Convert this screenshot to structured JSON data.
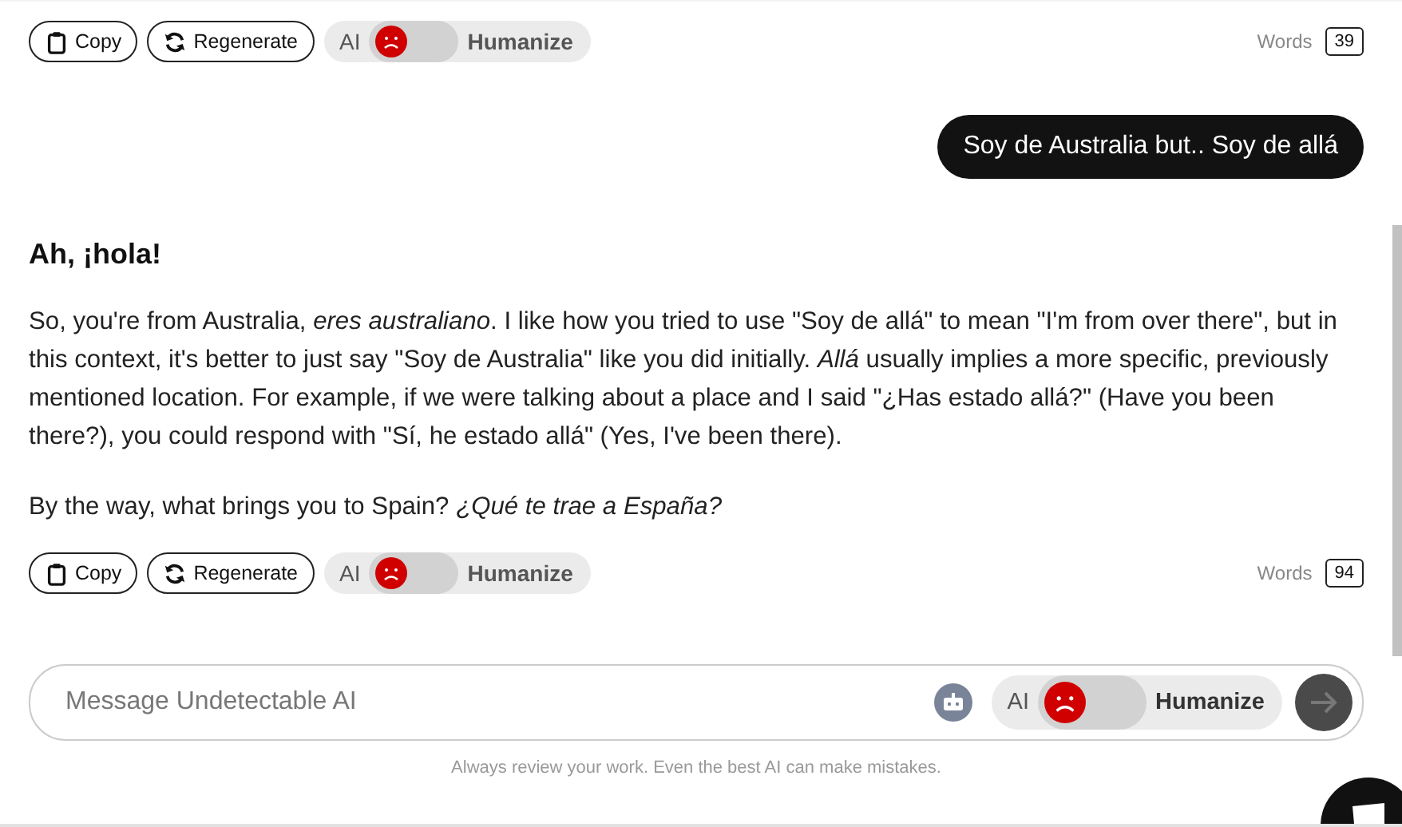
{
  "top_actions": {
    "buttons": [
      {
        "kind": "copy",
        "label": "Copy"
      },
      {
        "kind": "regenerate",
        "label": "Regenerate"
      }
    ],
    "toggle": {
      "left": "AI",
      "right": "Humanize",
      "on": false
    },
    "words": {
      "label": "Words",
      "count": "39"
    }
  },
  "user_message": "Soy de Australia but.. Soy de allá",
  "reply": {
    "heading": "Ah, ¡hola!",
    "paragraphs": [
      "So, you're from Australia, *eres australiano*. I like how you tried to use \"Soy de allá\" to mean \"I'm from over there\", but in this context, it's better to just say \"Soy de Australia\" like you did initially. *Allá* usually implies a more specific, previously mentioned location. For example, if we were talking about a place and I said \"¿Has estado allá?\" (Have you been there?), you could respond with \"Sí, he estado allá\" (Yes, I've been there).",
      "By the way, what brings you to Spain? *¿Qué te trae a España?*"
    ]
  },
  "reply_actions": {
    "buttons": [
      {
        "kind": "copy",
        "label": "Copy"
      },
      {
        "kind": "regenerate",
        "label": "Regenerate"
      }
    ],
    "toggle": {
      "left": "AI",
      "right": "Humanize",
      "on": false
    },
    "words": {
      "label": "Words",
      "count": "94"
    }
  },
  "composer": {
    "placeholder": "Message Undetectable AI",
    "toggle": {
      "left": "AI",
      "right": "Humanize",
      "on": false
    }
  },
  "disclaimer": "Always review your work. Even the best AI can make mistakes."
}
